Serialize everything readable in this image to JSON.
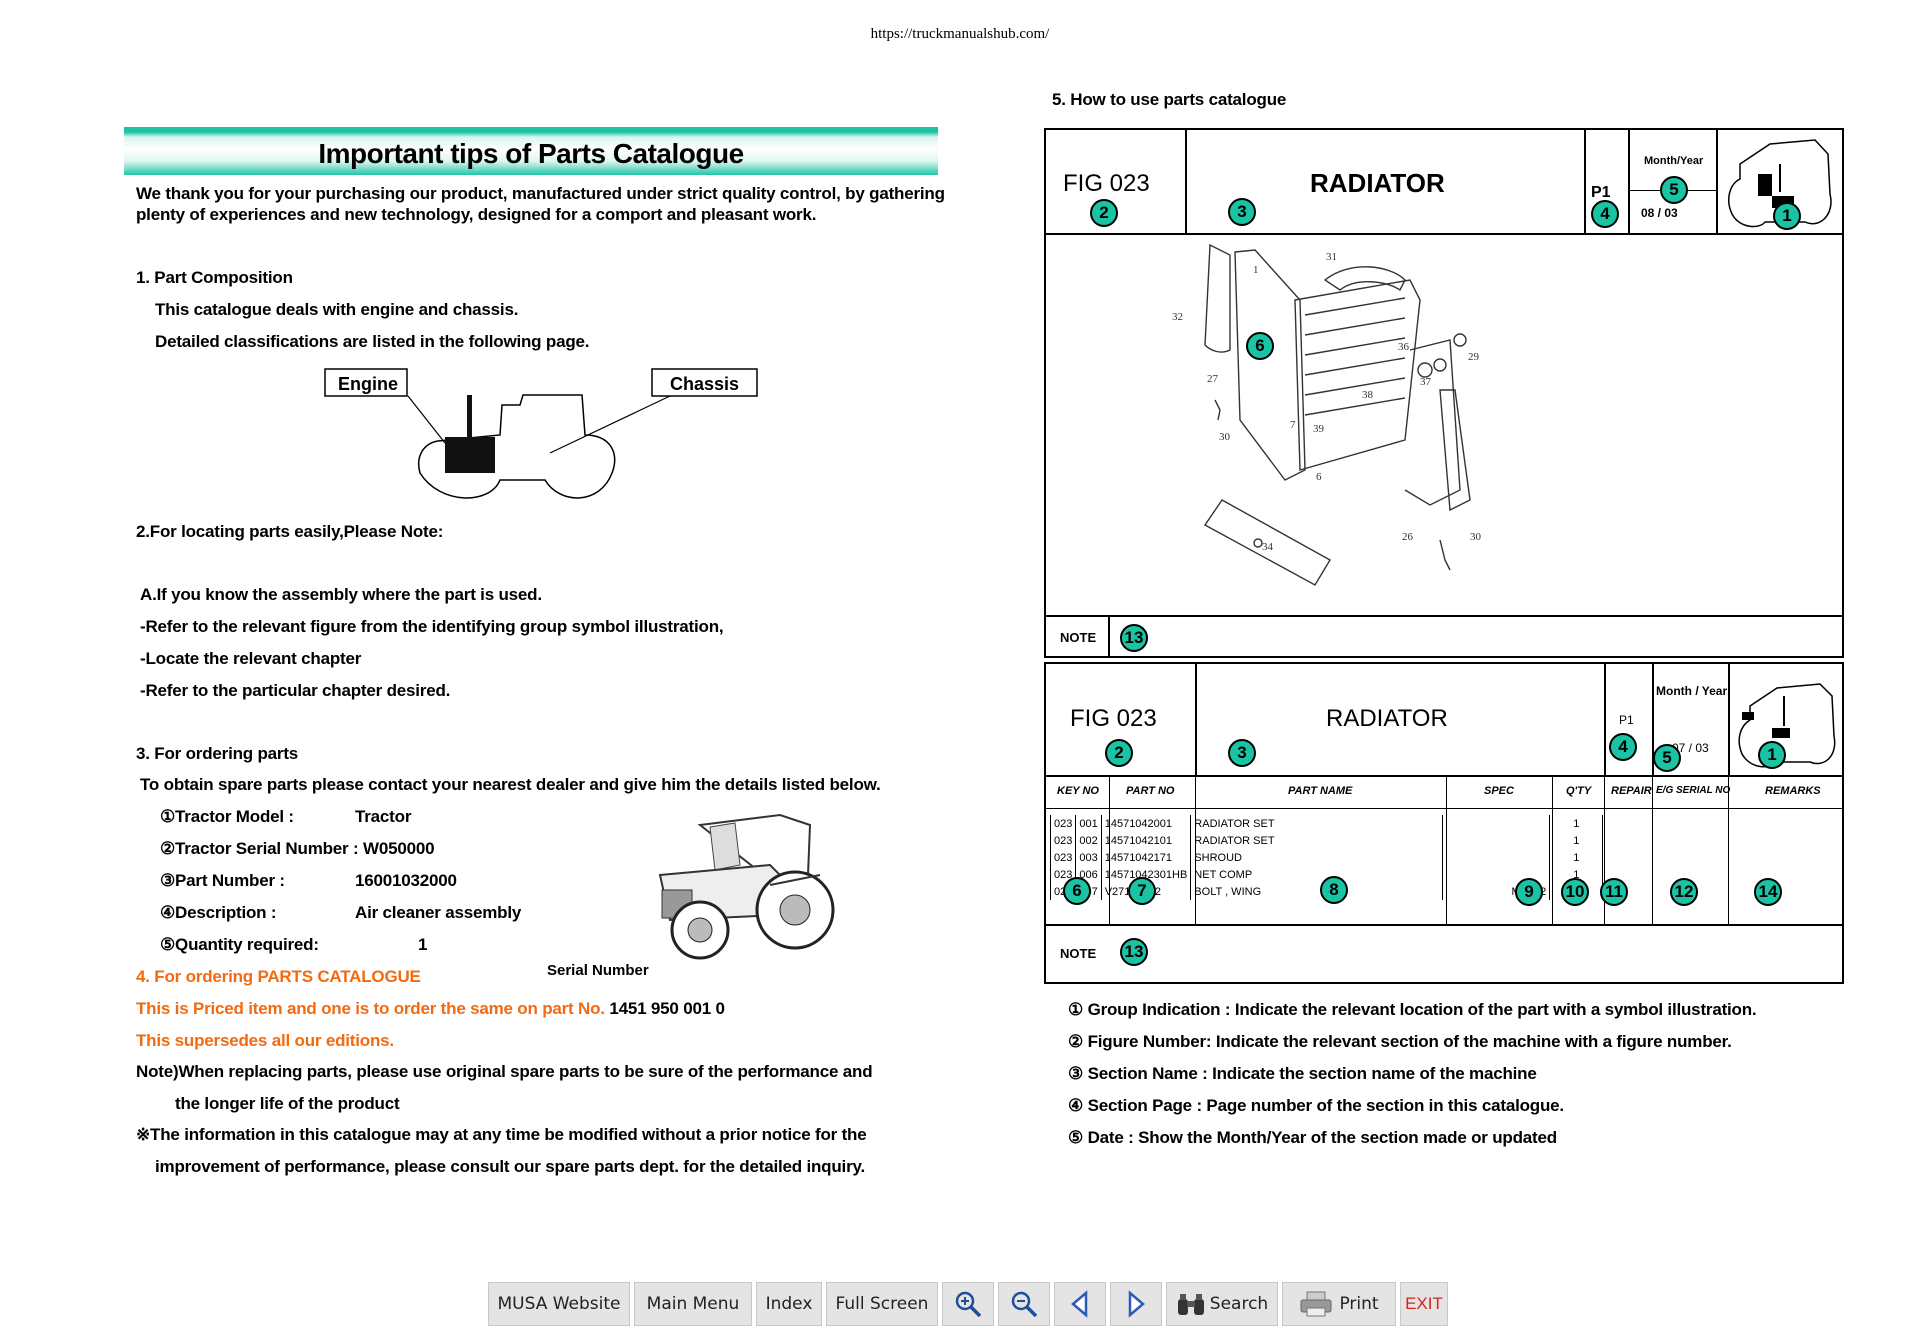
{
  "site_url": "https://truckmanualshub.com/",
  "left": {
    "banner_title": "Important tips of Parts Catalogue",
    "intro_line1": "We thank you for your purchasing our product, manufactured under strict quality control, by gathering",
    "intro_line2": "plenty of experiences and new technology, designed for a comport and pleasant work.",
    "sec1_title": "1. Part Composition",
    "sec1_line1": "This catalogue deals with engine and chassis.",
    "sec1_line2": "Detailed classifications are listed in the following page.",
    "engine_label": "Engine",
    "chassis_label": "Chassis",
    "sec2_title": "2.For locating parts easily,Please Note:",
    "sec2_a": "A.If you know the assembly where the part is used.",
    "sec2_b": "-Refer to the relevant figure from the identifying group symbol illustration,",
    "sec2_c": "-Locate the relevant chapter",
    "sec2_d": "-Refer to the particular chapter desired.",
    "sec3_title": "3. For ordering parts",
    "sec3_intro": "To obtain spare parts please contact your nearest dealer and give him the details listed below.",
    "order_items": [
      {
        "label": "①Tractor Model :",
        "value": "Tractor"
      },
      {
        "label": "②Tractor Serial Number : W050000",
        "value": ""
      },
      {
        "label": "③Part Number :",
        "value": "16001032000"
      },
      {
        "label": "④Description :",
        "value": "Air cleaner assembly"
      },
      {
        "label": "⑤Quantity required:",
        "value": "1"
      }
    ],
    "serial_label": "Serial Number",
    "sec4_title": "4. For ordering PARTS CATALOGUE",
    "sec4_line1": "This is Priced item and one is to order the same on part No.",
    "sec4_partno": "1451 950 001 0",
    "sec4_line2": "This supersedes all our editions.",
    "note1": "Note)When replacing parts, please use original spare parts to be sure of the performance and",
    "note2": "the longer life of the product",
    "note3": "※The information in this catalogue may at any time be modified without a prior notice for the",
    "note4": "improvement of performance,  please consult our spare parts dept. for the detailed inquiry."
  },
  "right": {
    "title": "5. How to use parts catalogue",
    "fig": "FIG 023",
    "section": "RADIATOR",
    "page": "P1",
    "month_year_label": "Month/Year",
    "month_year_label2": "Month / Year",
    "date": "08 / 03",
    "date2": "07 / 03",
    "note_label": "NOTE",
    "columns": [
      "KEY NO",
      "PART NO",
      "PART NAME",
      "SPEC",
      "Q'TY",
      "REPAIR",
      "E/G SERIAL NO",
      "REMARKS"
    ],
    "rows": [
      [
        "023",
        "001",
        "14571042001",
        "RADIATOR SET",
        "",
        "1"
      ],
      [
        "023",
        "002",
        "14571042101",
        "RADIATOR SET",
        "",
        "1"
      ],
      [
        "023",
        "003",
        "14571042171",
        "SHROUD",
        "",
        "1"
      ],
      [
        "023",
        "006",
        "14571042301HB",
        "NET COMP",
        "",
        "1"
      ],
      [
        "023",
        "007",
        "V27162012",
        "BOLT , WING",
        "M6X12",
        "4"
      ]
    ],
    "callout_numbers": [
      "1",
      "2",
      "3",
      "4",
      "5",
      "6",
      "7",
      "8",
      "9",
      "10",
      "11",
      "12",
      "13",
      "14"
    ],
    "diagram_numbers": [
      "1",
      "31",
      "32",
      "27",
      "30",
      "7",
      "39",
      "38",
      "36",
      "29",
      "37",
      "34",
      "26",
      "30",
      "6",
      "37",
      "39",
      "38",
      "30"
    ],
    "legend": [
      "① Group Indication  : Indicate the relevant location of the part with a symbol illustration.",
      "② Figure Number: Indicate the relevant section of the machine with a figure number.",
      "③ Section Name  : Indicate the section name of the machine",
      "④ Section Page   : Page number of the section in this catalogue.",
      "⑤ Date : Show the Month/Year of the section made or updated"
    ]
  },
  "toolbar": {
    "website": "MUSA Website",
    "main_menu": "Main Menu",
    "index": "Index",
    "full_screen": "Full Screen",
    "search": "Search",
    "print": "Print",
    "exit": "EXIT"
  },
  "colors": {
    "accent": "#19c3a3",
    "orange": "#f36a10",
    "exit_red": "#d6231e"
  }
}
